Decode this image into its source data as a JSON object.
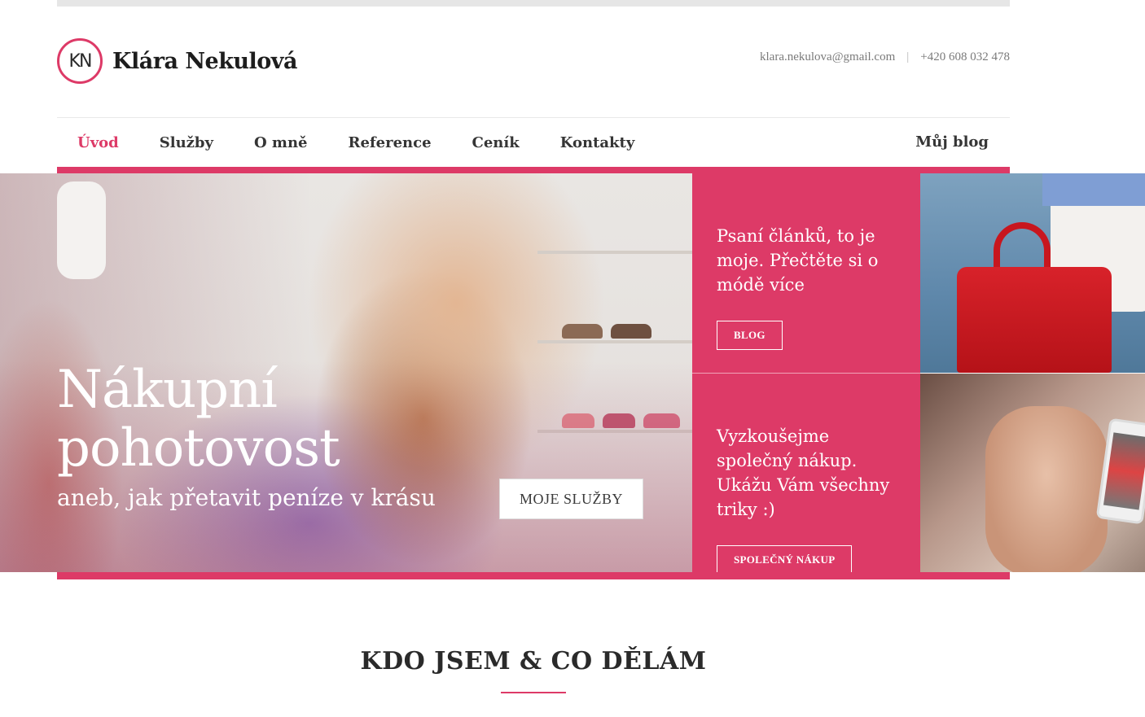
{
  "header": {
    "logo_initials": "KN",
    "logo_name": "Klára Nekulová",
    "email": "klara.nekulova@gmail.com",
    "separator": "|",
    "phone": "+420 608 032 478"
  },
  "nav": {
    "items": [
      {
        "label": "Úvod",
        "active": true
      },
      {
        "label": "Služby",
        "active": false
      },
      {
        "label": "O mně",
        "active": false
      },
      {
        "label": "Reference",
        "active": false
      },
      {
        "label": "Ceník",
        "active": false
      },
      {
        "label": "Kontakty",
        "active": false
      }
    ],
    "blog_label": "Můj blog"
  },
  "hero": {
    "title_line1": "Nákupní",
    "title_line2": "pohotovost",
    "subtitle": "aneb, jak přetavit peníze v krásu",
    "button_label": "MOJE SLUŽBY"
  },
  "panels": [
    {
      "text": "Psaní článků, to je moje. Přečtěte si o módě více",
      "button_label": "BLOG"
    },
    {
      "text": "Vyzkoušejme společný nákup. Ukážu Vám všechny triky :)",
      "button_label": "SPOLEČNÝ NÁKUP"
    }
  ],
  "section": {
    "title": "KDO JSEM & CO DĚLÁM"
  },
  "colors": {
    "accent": "#dd3a67",
    "text": "#2a2a2a",
    "muted": "#7a7a7a"
  }
}
